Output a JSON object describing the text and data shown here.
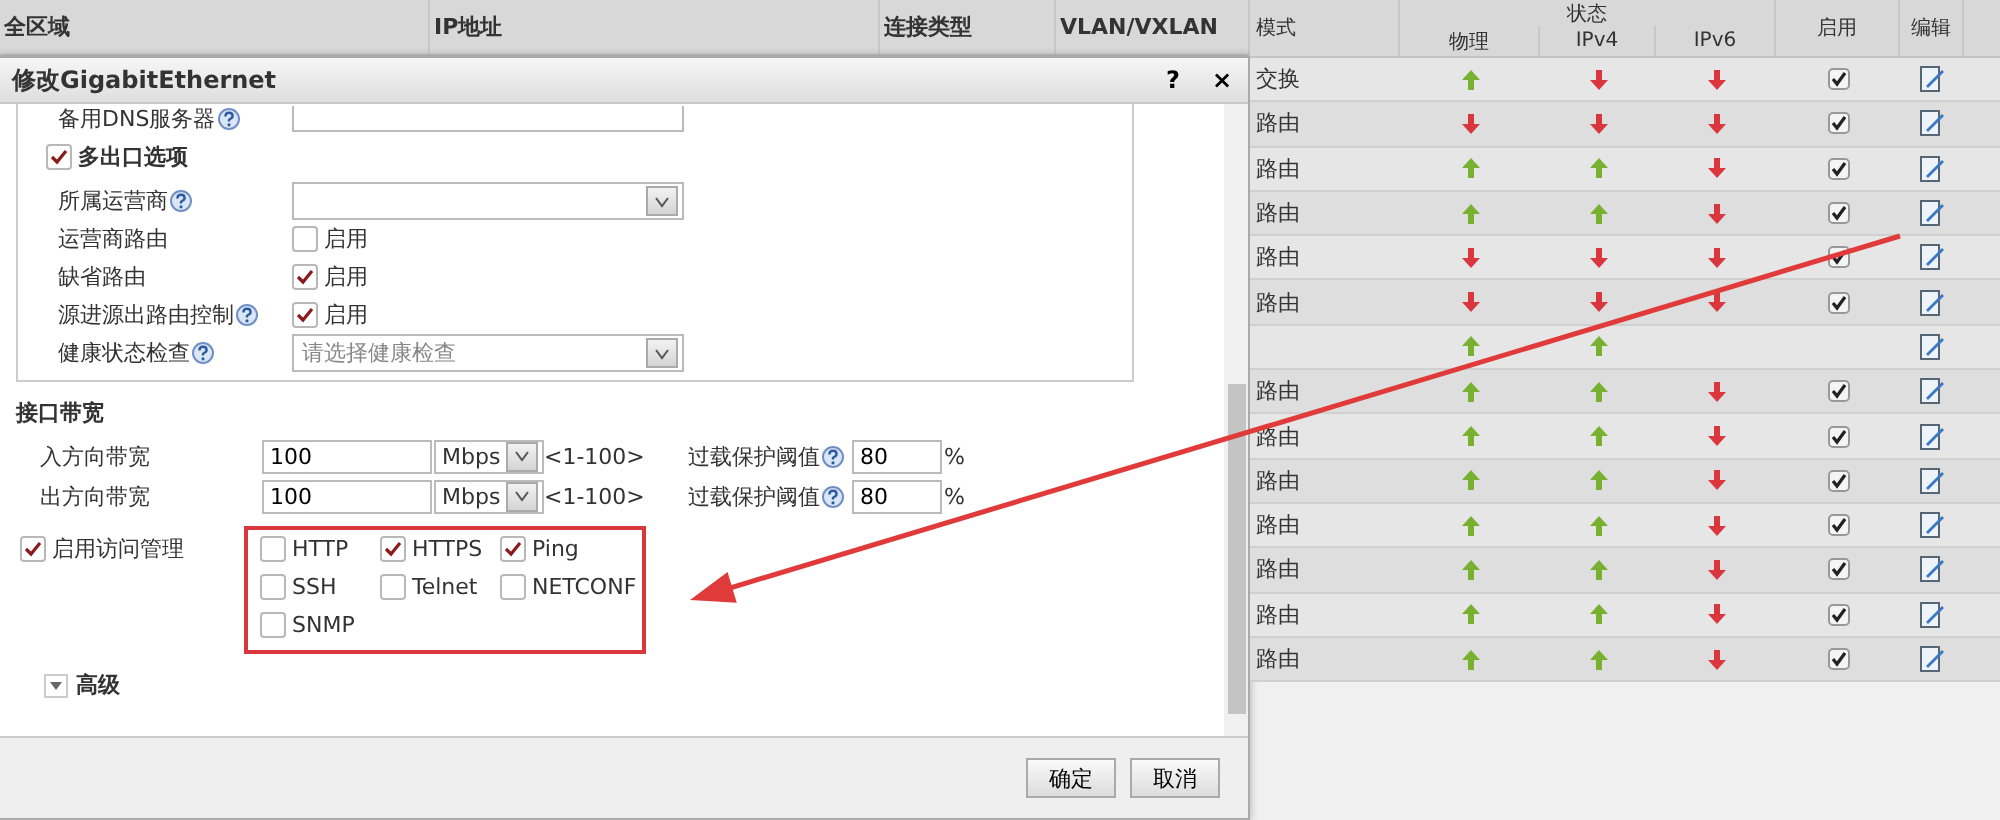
{
  "background_table": {
    "columns": [
      "全区域",
      "IP地址",
      "连接类型",
      "VLAN/VXLAN"
    ]
  },
  "dialog": {
    "title": "修改GigabitEthernet",
    "help": "?",
    "close": "×",
    "dns": {
      "label": "备用DNS服务器",
      "help": true
    },
    "multi_exit": {
      "label": "多出口选项",
      "checked": true
    },
    "fields": [
      {
        "kind": "select",
        "label": "所属运营商",
        "help": true
      },
      {
        "kind": "checkbox",
        "label": "运营商路由",
        "help": false,
        "option": "启用",
        "checked": false
      },
      {
        "kind": "checkbox",
        "label": "缺省路由",
        "help": false,
        "option": "启用",
        "checked": true
      },
      {
        "kind": "checkbox",
        "label": "源进源出路由控制",
        "help": true,
        "option": "启用",
        "checked": true
      },
      {
        "kind": "select",
        "label": "健康状态检查",
        "help": true,
        "placeholder": "请选择健康检查"
      }
    ],
    "bandwidth": {
      "title": "接口带宽",
      "rows": [
        {
          "label": "入方向带宽",
          "value": "100",
          "unit": "Mbps",
          "range": "<1-100>",
          "threshold_label": "过载保护阈值",
          "help": true,
          "threshold": "80",
          "percent": "%"
        },
        {
          "label": "出方向带宽",
          "value": "100",
          "unit": "Mbps",
          "range": "<1-100>",
          "threshold_label": "过载保护阈值",
          "help": true,
          "threshold": "80",
          "percent": "%"
        }
      ]
    },
    "access": {
      "label": "启用访问管理",
      "checked": true,
      "options": [
        {
          "label": "HTTP",
          "checked": false
        },
        {
          "label": "HTTPS",
          "checked": true
        },
        {
          "label": "Ping",
          "checked": true
        },
        {
          "label": "SSH",
          "checked": false
        },
        {
          "label": "Telnet",
          "checked": false
        },
        {
          "label": "NETCONF",
          "checked": false
        },
        {
          "label": "SNMP",
          "checked": false
        }
      ]
    },
    "advanced": {
      "label": "高级"
    },
    "buttons": [
      "确定",
      "取消"
    ]
  },
  "status_table": {
    "columns": {
      "mode": "模式",
      "status": "状态",
      "physical": "物理",
      "ipv4": "IPv4",
      "ipv6": "IPv6",
      "enabled": "启用",
      "edit": "编辑"
    },
    "rows": [
      {
        "mode": "交换",
        "physical_up": true,
        "ipv4_up": false,
        "ipv6_up": false,
        "enabled": true
      },
      {
        "mode": "路由",
        "physical_up": false,
        "ipv4_up": false,
        "ipv6_up": false,
        "enabled": true
      },
      {
        "mode": "路由",
        "physical_up": true,
        "ipv4_up": true,
        "ipv6_up": false,
        "enabled": true
      },
      {
        "mode": "路由",
        "physical_up": true,
        "ipv4_up": true,
        "ipv6_up": false,
        "enabled": true
      },
      {
        "mode": "路由",
        "physical_up": false,
        "ipv4_up": false,
        "ipv6_up": false,
        "enabled": true
      },
      {
        "mode": "路由",
        "physical_up": false,
        "ipv4_up": false,
        "ipv6_up": false,
        "enabled": true
      },
      {
        "physical_up": true,
        "ipv4_up": true
      },
      {
        "mode": "路由",
        "physical_up": true,
        "ipv4_up": true,
        "ipv6_up": false,
        "enabled": true
      },
      {
        "mode": "路由",
        "physical_up": true,
        "ipv4_up": true,
        "ipv6_up": false,
        "enabled": true
      },
      {
        "mode": "路由",
        "physical_up": true,
        "ipv4_up": true,
        "ipv6_up": false,
        "enabled": true
      },
      {
        "mode": "路由",
        "physical_up": true,
        "ipv4_up": true,
        "ipv6_up": false,
        "enabled": true
      },
      {
        "mode": "路由",
        "physical_up": true,
        "ipv4_up": true,
        "ipv6_up": false,
        "enabled": true
      },
      {
        "mode": "路由",
        "physical_up": true,
        "ipv4_up": true,
        "ipv6_up": false,
        "enabled": true
      },
      {
        "mode": "路由",
        "physical_up": true,
        "ipv4_up": true,
        "ipv6_up": false,
        "enabled": true
      }
    ]
  }
}
